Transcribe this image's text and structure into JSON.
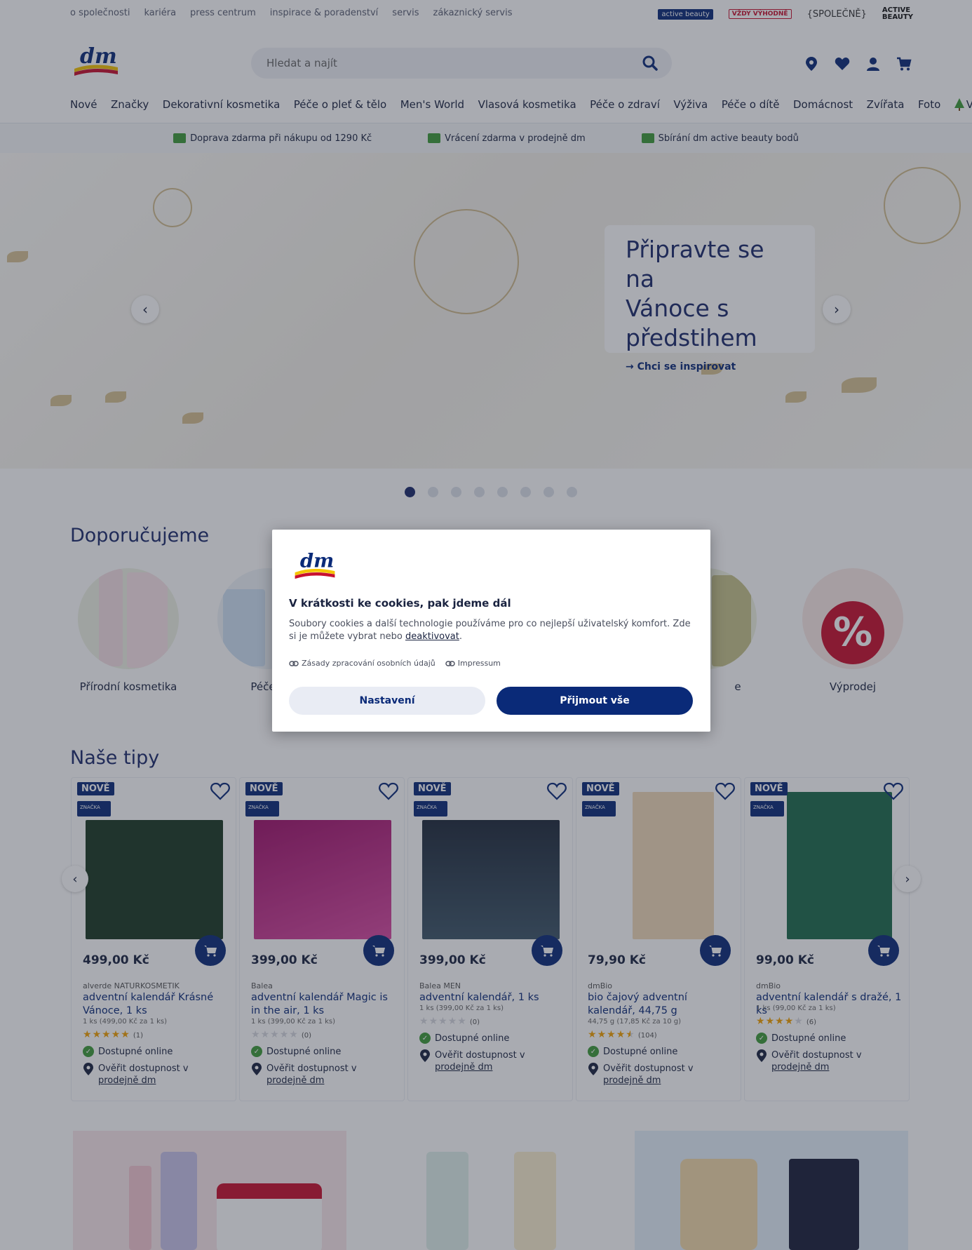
{
  "meta_nav": [
    "o společnosti",
    "kariéra",
    "press centrum",
    "inspirace & poradenství",
    "servis",
    "zákaznický servis"
  ],
  "brand_logos": {
    "active_beauty": "active beauty",
    "vzdy_vyhodne": "VŽDY VÝHODNĚ",
    "spolecne": "{SPOLEČNĚ}",
    "active_beauty_word_1": "ACTIVE",
    "active_beauty_word_2": "BEAUTY"
  },
  "header": {
    "logo_text": "dm",
    "search_placeholder": "Hledat a najít"
  },
  "main_nav": [
    "Nové",
    "Značky",
    "Dekorativní kosmetika",
    "Péče o pleť & tělo",
    "Men's World",
    "Vlasová kosmetika",
    "Péče o zdraví",
    "Výživa",
    "Péče o dítě",
    "Domácnost",
    "Zvířata",
    "Foto",
    "Vánoce"
  ],
  "usp": [
    "Doprava zdarma při nákupu od 1290 Kč",
    "Vrácení zdarma v prodejně dm",
    "Sbírání dm active beauty bodů"
  ],
  "hero": {
    "title_line1": "Připravte se na",
    "title_line2": "Vánoce s",
    "title_line3": "předstihem",
    "link": "→ Chci se inspirovat"
  },
  "hero_pager": {
    "total": 8,
    "active": 1
  },
  "recommend": {
    "heading": "Doporučujeme",
    "items": [
      {
        "label": "Přírodní kosmetika"
      },
      {
        "label": "Péče o"
      },
      {
        "label": "e"
      },
      {
        "label": "Výprodej",
        "icon": "%"
      }
    ]
  },
  "tips": {
    "heading": "Naše tipy",
    "products": [
      {
        "badge": "NOVĚ",
        "badge_brand": "ZNAČKA",
        "price": "499,00 Kč",
        "brand": "alverde NATURKOSMETIK",
        "name": "adventní kalendář Krásné Vánoce, 1 ks",
        "unit": "1 ks (499,00 Kč za 1 ks)",
        "rating": 5,
        "reviews": "(1)",
        "avail": "Dostupné online",
        "store_line1": "Ověřit dostupnost v",
        "store_line2": "prodejně dm"
      },
      {
        "badge": "NOVĚ",
        "badge_brand": "ZNAČKA",
        "price": "399,00 Kč",
        "brand": "Balea",
        "name": "adventní kalendář Magic is in the air, 1 ks",
        "unit": "1 ks (399,00 Kč za 1 ks)",
        "rating": 0,
        "reviews": "(0)",
        "avail": "Dostupné online",
        "store_line1": "Ověřit dostupnost v",
        "store_line2": "prodejně dm"
      },
      {
        "badge": "NOVĚ",
        "badge_brand": "ZNAČKA",
        "price": "399,00 Kč",
        "brand": "Balea MEN",
        "name": "adventní kalendář, 1 ks",
        "unit": "1 ks (399,00 Kč za 1 ks)",
        "rating": 0,
        "reviews": "(0)",
        "avail": "Dostupné online",
        "store_line1": "Ověřit dostupnost v",
        "store_line2": "prodejně dm"
      },
      {
        "badge": "NOVĚ",
        "badge_brand": "ZNAČKA",
        "price": "79,90 Kč",
        "brand": "dmBio",
        "name": "bio čajový adventní kalendář, 44,75 g",
        "unit": "44,75 g (17,85 Kč za 10 g)",
        "rating": 4.5,
        "reviews": "(104)",
        "avail": "Dostupné online",
        "store_line1": "Ověřit dostupnost v",
        "store_line2": "prodejně dm"
      },
      {
        "badge": "NOVĚ",
        "badge_brand": "ZNAČKA",
        "price": "99,00 Kč",
        "brand": "dmBio",
        "name": "adventní kalendář s dražé, 1 ks",
        "unit": "1 ks (99,00 Kč za 1 ks)",
        "rating": 4,
        "reviews": "(6)",
        "avail": "Dostupné online",
        "store_line1": "Ověřit dostupnost v",
        "store_line2": "prodejně dm"
      }
    ]
  },
  "cookie_modal": {
    "logo_text": "dm",
    "title": "V krátkosti ke cookies, pak jdeme dál",
    "text": "Soubory cookies a další technologie používáme pro co nejlepší uživatelský komfort. Zde si je můžete vybrat nebo",
    "link_deactivate": "deaktivovat",
    "link_privacy": "Zásady zpracování osobních údajů",
    "link_impressum": "Impressum",
    "btn_settings": "Nastavení",
    "btn_accept": "Přijmout vše"
  },
  "colors": {
    "brand_navy": "#0a2a78",
    "dm_yellow": "#f5c400",
    "dm_red": "#c8102e",
    "online_green": "#3f9b3a",
    "star": "#f2a100"
  }
}
